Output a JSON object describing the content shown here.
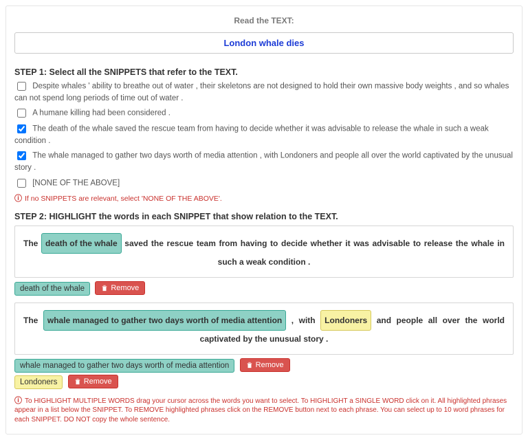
{
  "header": {
    "read_label": "Read the TEXT:",
    "text": "London whale dies"
  },
  "step1": {
    "heading": "STEP 1: Select all the SNIPPETS that refer to the TEXT.",
    "snippets": [
      {
        "label": "Despite whales ' ability to breathe out of water , their skeletons are not designed to hold their own massive body weights , and so whales can not spend long periods of time out of water .",
        "checked": false
      },
      {
        "label": "A humane killing had been considered .",
        "checked": false
      },
      {
        "label": "The death of the whale saved the rescue team from having to decide whether it was advisable to release the whale in such a weak condition .",
        "checked": true
      },
      {
        "label": "The whale managed to gather two days worth of media attention , with Londoners and people all over the world captivated by the unusual story .",
        "checked": true
      },
      {
        "label": "[NONE OF THE ABOVE]",
        "checked": false
      }
    ],
    "hint": "If no SNIPPETS are relevant, select 'NONE OF THE ABOVE'."
  },
  "step2": {
    "heading": "STEP 2: HIGHLIGHT the words in each SNIPPET that show relation to the TEXT.",
    "remove_label": "Remove",
    "boxes": [
      {
        "pre": "The",
        "highlight1": "death of the whale",
        "mid": "saved the rescue team from having to decide whether it was advisable to release the whale in such a weak condition .",
        "tags": [
          {
            "text": "death of the whale",
            "style": "teal"
          }
        ]
      },
      {
        "pre": "The",
        "highlight1": "whale managed to gather two days worth of media attention",
        "mid1": ", with",
        "highlight2": "Londoners",
        "mid2": "and people all over the world captivated by the unusual story .",
        "tags": [
          {
            "text": "whale managed to gather two days worth of media attention",
            "style": "teal"
          },
          {
            "text": "Londoners",
            "style": "yellow"
          }
        ]
      }
    ],
    "instructions": "To HIGHLIGHT MULTIPLE WORDS drag your cursor across the words you want to select. To HIGHLIGHT a SINGLE WORD click on it. All highlighted phrases appear in a list below the SNIPPET. To REMOVE highlighted phrases click on the REMOVE button next to each phrase. You can select up to 10 word phrases for each SNIPPET. DO NOT copy the whole sentence."
  }
}
